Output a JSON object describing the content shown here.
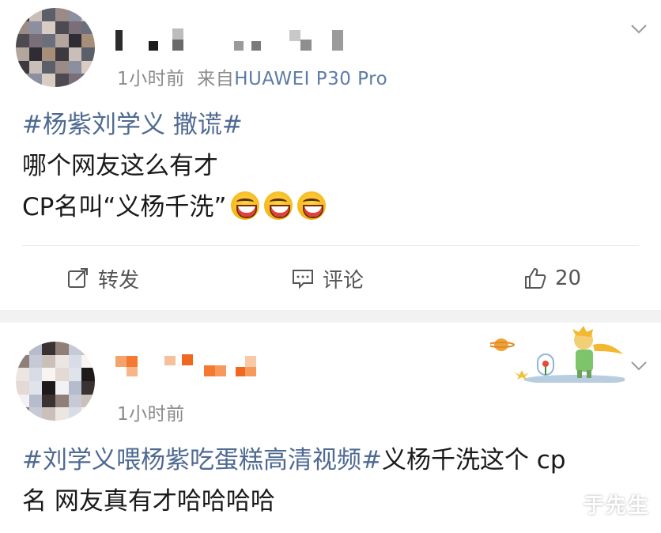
{
  "post1": {
    "time": "1小时前",
    "source_prefix": "来自",
    "source_device": "HUAWEI P30 Pro",
    "topic": "#杨紫刘学义 撒谎#",
    "line2": "哪个网友这么有才",
    "line3": "CP名叫“义杨千洗”",
    "emoji_name": "laughing-emoji",
    "actions": {
      "repost": "转发",
      "comment": "评论",
      "like_count": "20"
    }
  },
  "post2": {
    "time": "1小时前",
    "topic": "#刘学义喂杨紫吃蛋糕高清视频#",
    "text_after_topic": "义杨千洗这个 cp",
    "line2": "名 网友真有才哈哈哈哈"
  },
  "watermark": "于先生",
  "colors": {
    "topic_link": "#4f6a92",
    "meta_gray": "#8a8a8a",
    "source_link": "#5d7ba6",
    "separator": "#f2f2f2"
  }
}
